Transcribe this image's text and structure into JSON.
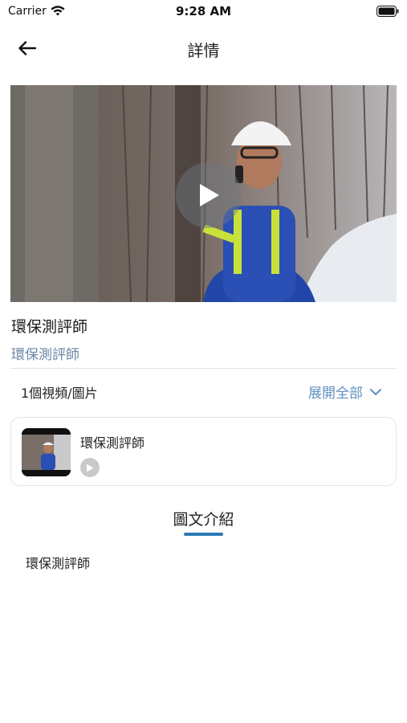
{
  "status_bar": {
    "carrier": "Carrier",
    "time": "9:28 AM",
    "icons": [
      "wifi-icon",
      "battery-icon"
    ]
  },
  "nav": {
    "title": "詳情",
    "back_icon": "arrow-left-icon"
  },
  "video": {
    "play_icon": "play-icon"
  },
  "detail": {
    "title": "環保測評師",
    "subtitle": "環保測評師"
  },
  "media": {
    "count_label": "1個視頻/圖片",
    "expand_label": "展開全部",
    "expand_icon": "chevron-down-icon",
    "items": [
      {
        "title": "環保測評師",
        "play_icon": "play-icon"
      }
    ]
  },
  "tabs": [
    {
      "label": "圖文介紹",
      "active": true
    }
  ],
  "content": {
    "text": "環保測評師"
  },
  "colors": {
    "accent": "#2b79b5",
    "link": "#5f8fc1",
    "subtitle": "#6b86a6",
    "divider": "#e2e2e2"
  }
}
